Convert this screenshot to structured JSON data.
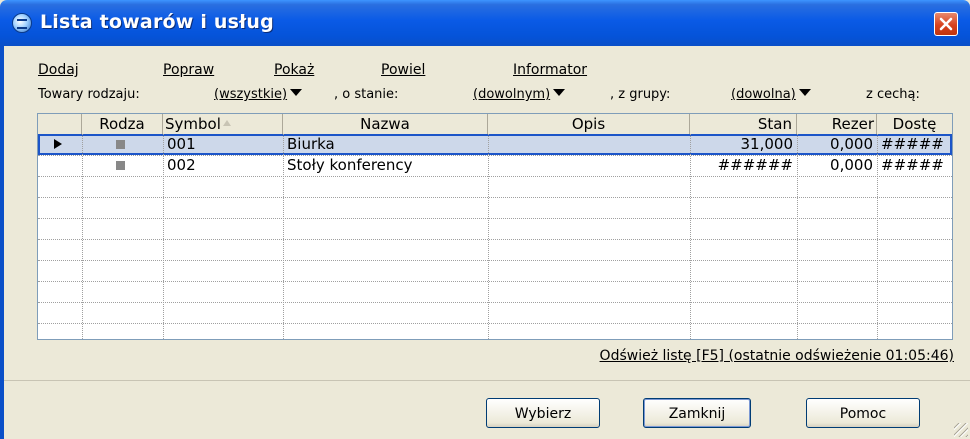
{
  "window": {
    "title": "Lista towarów i usług"
  },
  "toolbar": {
    "add": "Dodaj",
    "edit": "Popraw",
    "show": "Pokaż",
    "duplicate": "Powiel",
    "info": "Informator"
  },
  "filters": {
    "type_label": "Towary rodzaju:",
    "type_value": "(wszystkie)",
    "state_label": ", o stanie:",
    "state_value": "(dowolnym)",
    "group_label": ", z grupy:",
    "group_value": "(dowolna)",
    "feature_label": "z cechą:"
  },
  "table": {
    "columns": [
      "Rodza",
      "Symbol",
      "Nazwa",
      "Opis",
      "Stan",
      "Rezer",
      "Dostę"
    ],
    "rows": [
      {
        "symbol": "001",
        "name": "Biurka",
        "desc": "",
        "stock": "31,000",
        "reserved": "0,000",
        "available": "#####"
      },
      {
        "symbol": "002",
        "name": "Stoły konferency",
        "desc": "",
        "stock": "######",
        "reserved": "0,000",
        "available": "#####"
      }
    ]
  },
  "refresh": "Odśwież listę [F5] (ostatnie odświeżenie 01:05:46)",
  "buttons": {
    "select": "Wybierz",
    "close": "Zamknij",
    "help": "Pomoc"
  },
  "colors": {
    "titlebar": "#0a5ae6",
    "selected_row": "#cdd8ea",
    "close_button": "#d8431f"
  }
}
